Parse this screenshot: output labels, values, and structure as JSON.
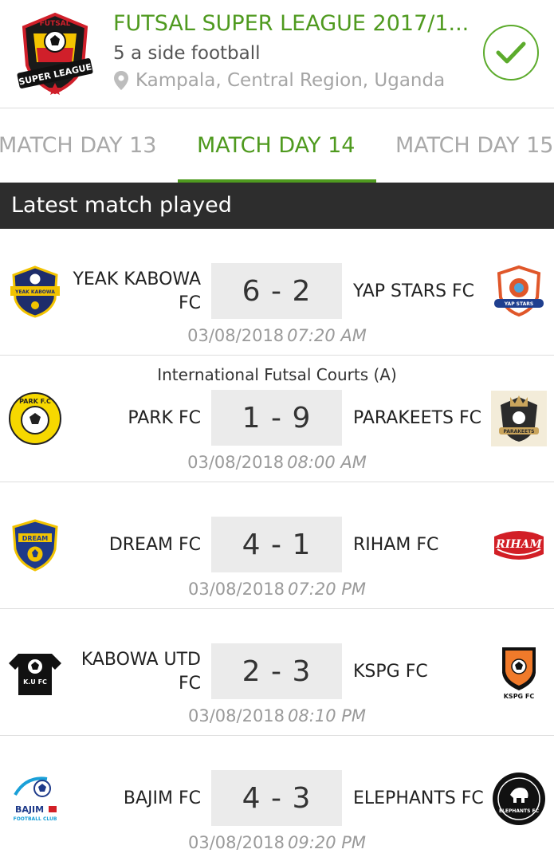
{
  "league": {
    "title": "FUTSAL SUPER LEAGUE 2017/1...",
    "subtitle": "5 a side football",
    "location": "Kampala, Central Region, Uganda",
    "logo_text_top": "FUTSAL",
    "logo_text_banner": "SUPER LEAGUE"
  },
  "tabs": [
    {
      "label": "MATCH DAY 13"
    },
    {
      "label": "MATCH DAY 14"
    },
    {
      "label": "MATCH DAY 15"
    }
  ],
  "section": {
    "title": "Latest match played"
  },
  "matches": [
    {
      "home": "YEAK KABOWA FC",
      "away": "YAP STARS FC",
      "score": "6 - 2",
      "date": "03/08/2018",
      "time": "07:20 AM",
      "venue": ""
    },
    {
      "home": "PARK FC",
      "away": "PARAKEETS FC",
      "score": "1 - 9",
      "date": "03/08/2018",
      "time": "08:00 AM",
      "venue": "International Futsal Courts (A)"
    },
    {
      "home": "DREAM FC",
      "away": "RIHAM FC",
      "score": "4 - 1",
      "date": "03/08/2018",
      "time": "07:20 PM",
      "venue": ""
    },
    {
      "home": "KABOWA UTD FC",
      "away": "KSPG FC",
      "score": "2 - 3",
      "date": "03/08/2018",
      "time": "08:10 PM",
      "venue": ""
    },
    {
      "home": "BAJIM FC",
      "away": "ELEPHANTS FC",
      "score": "4 - 3",
      "date": "03/08/2018",
      "time": "09:20 PM",
      "venue": ""
    }
  ],
  "logos": {
    "yap_stars": "YAP STARS",
    "parakeets": "PARAKEETS",
    "riham": "RIHAM",
    "ksfc": "KSPG FC",
    "kufc": "K.U FC",
    "bajim": "BAJIM",
    "bajim_sub": "FOOTBALL CLUB",
    "dream": "DREAM",
    "park": "PARK F.C",
    "yeak": "YEAK KABOWA",
    "elephants": "ELEPHANTS FC"
  },
  "colors": {
    "accent": "#4f9a1f",
    "section_bg": "#2d2d2d"
  }
}
